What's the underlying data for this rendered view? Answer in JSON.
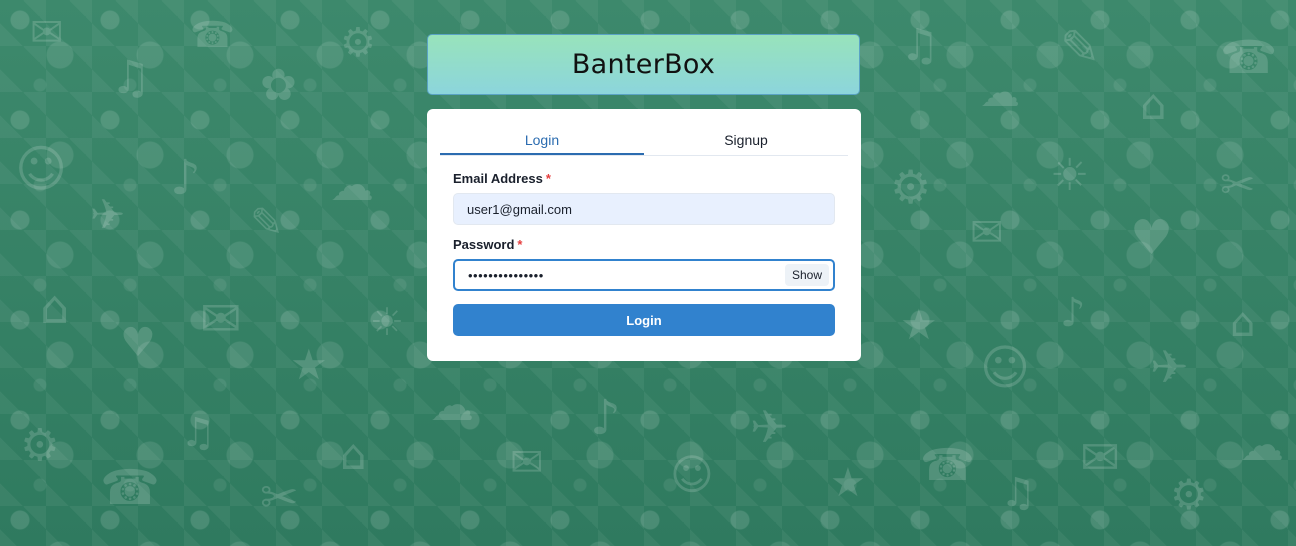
{
  "app": {
    "title": "BanterBox"
  },
  "tabs": [
    {
      "label": "Login",
      "active": true
    },
    {
      "label": "Signup",
      "active": false
    }
  ],
  "form": {
    "email_label": "Email Address",
    "email_value": "user1@gmail.com",
    "password_label": "Password",
    "password_value": "123456789012345",
    "required_marker": "*",
    "show_label": "Show",
    "login_label": "Login"
  },
  "colors": {
    "accent": "#3182ce",
    "background": "#3f8a6e",
    "header_gradient_top": "#98e3bb",
    "header_gradient_bottom": "#8cd5dc"
  },
  "icons": [
    "background-pattern-icons"
  ]
}
